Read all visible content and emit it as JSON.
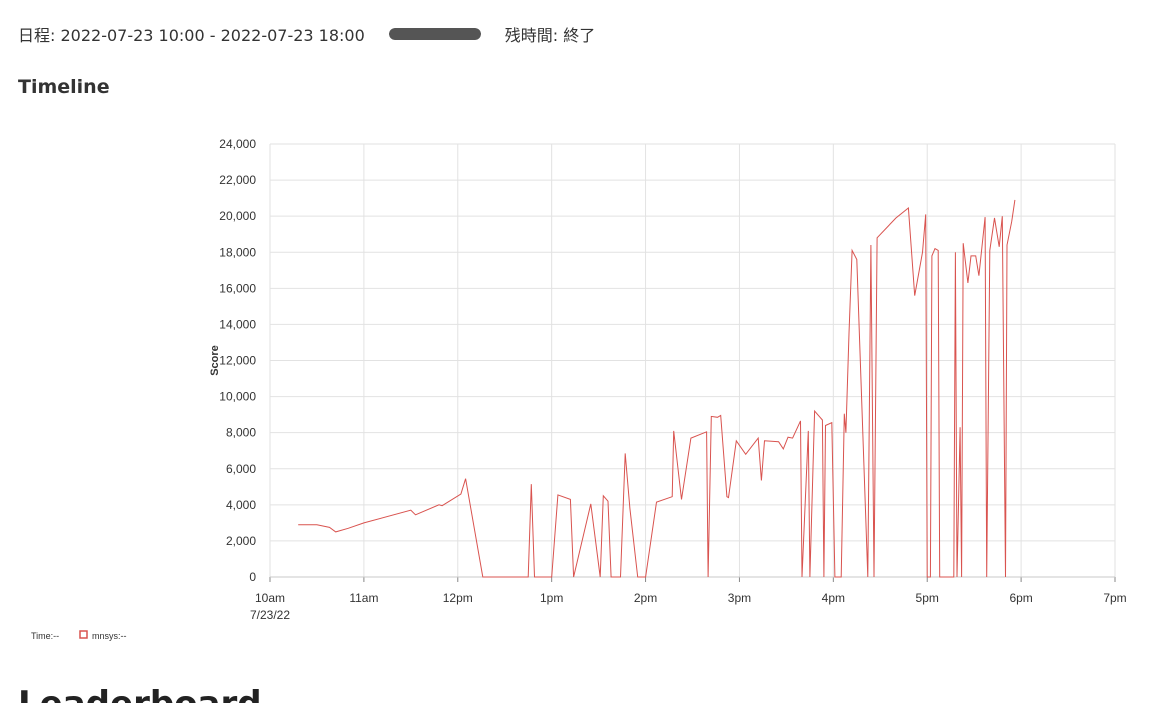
{
  "schedule": {
    "text": "日程: 2022-07-23 10:00 - 2022-07-23 18:00",
    "progress": 1.0,
    "remaining": "残時間: 終了"
  },
  "timeline": {
    "title": "Timeline"
  },
  "bottom_heading": "Leaderboard",
  "legend": {
    "time_label": "Time:--",
    "series_label": "mnsys:--"
  },
  "colors": {
    "series": "#d9534f",
    "progress": "#555555",
    "grid": "#e2e2e2"
  },
  "chart_data": {
    "type": "line",
    "title": "",
    "xlabel": "",
    "ylabel": "Score",
    "xlim": [
      "10:00",
      "19:00"
    ],
    "ylim": [
      0,
      24000
    ],
    "grid": true,
    "legend_position": "bottom-left",
    "x_ticks": [
      "10am",
      "11am",
      "12pm",
      "1pm",
      "2pm",
      "3pm",
      "4pm",
      "5pm",
      "6pm",
      "7pm"
    ],
    "x_subtick": "7/23/22",
    "y_ticks": [
      "0",
      "2,000",
      "4,000",
      "6,000",
      "8,000",
      "10,000",
      "12,000",
      "14,000",
      "16,000",
      "18,000",
      "20,000",
      "22,000",
      "24,000"
    ],
    "series": [
      {
        "name": "mnsys",
        "points": [
          [
            "10:18",
            2900
          ],
          [
            "10:30",
            2900
          ],
          [
            "10:38",
            2750
          ],
          [
            "10:42",
            2500
          ],
          [
            "10:50",
            2700
          ],
          [
            "11:00",
            3000
          ],
          [
            "11:30",
            3700
          ],
          [
            "11:33",
            3450
          ],
          [
            "11:48",
            4000
          ],
          [
            "11:50",
            3950
          ],
          [
            "12:02",
            4600
          ],
          [
            "12:05",
            5450
          ],
          [
            "12:16",
            0
          ],
          [
            "12:45",
            0
          ],
          [
            "12:47",
            5150
          ],
          [
            "12:49",
            0
          ],
          [
            "13:00",
            0
          ],
          [
            "13:04",
            4550
          ],
          [
            "13:12",
            4300
          ],
          [
            "13:14",
            0
          ],
          [
            "13:25",
            4050
          ],
          [
            "13:31",
            0
          ],
          [
            "13:33",
            4500
          ],
          [
            "13:36",
            4200
          ],
          [
            "13:38",
            0
          ],
          [
            "13:44",
            0
          ],
          [
            "13:47",
            6850
          ],
          [
            "13:50",
            3800
          ],
          [
            "13:55",
            0
          ],
          [
            "14:00",
            0
          ],
          [
            "14:07",
            4150
          ],
          [
            "14:17",
            4450
          ],
          [
            "14:18",
            8100
          ],
          [
            "14:23",
            4300
          ],
          [
            "14:29",
            7700
          ],
          [
            "14:39",
            8050
          ],
          [
            "14:40",
            0
          ],
          [
            "14:42",
            8900
          ],
          [
            "14:46",
            8850
          ],
          [
            "14:48",
            8950
          ],
          [
            "14:52",
            4450
          ],
          [
            "14:53",
            4400
          ],
          [
            "14:58",
            7550
          ],
          [
            "15:04",
            6800
          ],
          [
            "15:12",
            7700
          ],
          [
            "15:14",
            5350
          ],
          [
            "15:16",
            7550
          ],
          [
            "15:25",
            7500
          ],
          [
            "15:28",
            7100
          ],
          [
            "15:31",
            7750
          ],
          [
            "15:34",
            7700
          ],
          [
            "15:39",
            8650
          ],
          [
            "15:40",
            0
          ],
          [
            "15:44",
            8100
          ],
          [
            "15:45",
            0
          ],
          [
            "15:48",
            9200
          ],
          [
            "15:51",
            8900
          ],
          [
            "15:53",
            8700
          ],
          [
            "15:54",
            0
          ],
          [
            "15:55",
            8400
          ],
          [
            "15:59",
            8550
          ],
          [
            "16:01",
            0
          ],
          [
            "16:05",
            0
          ],
          [
            "16:07",
            9050
          ],
          [
            "16:08",
            8000
          ],
          [
            "16:10",
            13500
          ],
          [
            "16:12",
            18100
          ],
          [
            "16:15",
            17600
          ],
          [
            "16:22",
            0
          ],
          [
            "16:24",
            18400
          ],
          [
            "16:26",
            0
          ],
          [
            "16:28",
            18800
          ],
          [
            "16:40",
            19900
          ],
          [
            "16:48",
            20450
          ],
          [
            "16:52",
            15600
          ],
          [
            "16:57",
            18000
          ],
          [
            "16:59",
            20100
          ],
          [
            "17:00",
            0
          ],
          [
            "17:02",
            0
          ],
          [
            "17:03",
            17800
          ],
          [
            "17:05",
            18200
          ],
          [
            "17:07",
            18100
          ],
          [
            "17:08",
            0
          ],
          [
            "17:15",
            0
          ],
          [
            "17:17",
            0
          ],
          [
            "17:18",
            18000
          ],
          [
            "17:19",
            0
          ],
          [
            "17:21",
            8300
          ],
          [
            "17:22",
            0
          ],
          [
            "17:23",
            18500
          ],
          [
            "17:26",
            16300
          ],
          [
            "17:28",
            17800
          ],
          [
            "17:31",
            17800
          ],
          [
            "17:33",
            16700
          ],
          [
            "17:37",
            19950
          ],
          [
            "17:38",
            0
          ],
          [
            "17:40",
            18100
          ],
          [
            "17:43",
            19900
          ],
          [
            "17:46",
            18300
          ],
          [
            "17:48",
            20000
          ],
          [
            "17:50",
            0
          ],
          [
            "17:51",
            18400
          ],
          [
            "17:54",
            19700
          ],
          [
            "17:56",
            20900
          ]
        ]
      }
    ]
  }
}
